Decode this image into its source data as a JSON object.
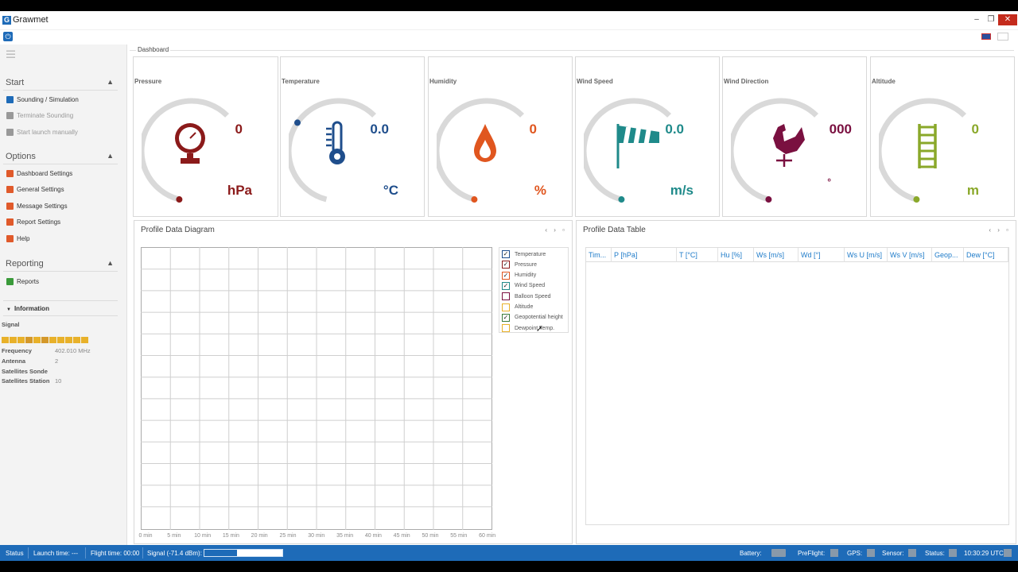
{
  "window": {
    "title": "Grawmet",
    "minimize": "–",
    "maximize": "❐",
    "close": "✕"
  },
  "sidebar": {
    "sections": [
      {
        "title": "Start",
        "items": [
          {
            "label": "Sounding / Simulation",
            "color": "#1e6bb8",
            "disabled": false
          },
          {
            "label": "Terminate Sounding",
            "color": "#999999",
            "disabled": true
          },
          {
            "label": "Start launch manually",
            "color": "#999999",
            "disabled": true
          }
        ]
      },
      {
        "title": "Options",
        "items": [
          {
            "label": "Dashboard Settings",
            "color": "#e05a2b",
            "disabled": false
          },
          {
            "label": "General Settings",
            "color": "#e05a2b",
            "disabled": false
          },
          {
            "label": "Message Settings",
            "color": "#e05a2b",
            "disabled": false
          },
          {
            "label": "Report Settings",
            "color": "#e05a2b",
            "disabled": false
          },
          {
            "label": "Help",
            "color": "#e05a2b",
            "disabled": false
          }
        ]
      },
      {
        "title": "Reporting",
        "items": [
          {
            "label": "Reports",
            "color": "#3a9a3a",
            "disabled": false
          }
        ]
      }
    ],
    "information": {
      "title": "Information",
      "signal_label": "Signal",
      "rows": [
        {
          "label": "Frequency",
          "value": "402.010 MHz"
        },
        {
          "label": "Antenna",
          "value": "2"
        },
        {
          "label": "Satellites Sonde",
          "value": ""
        },
        {
          "label": "Satellites Station",
          "value": "10"
        }
      ]
    }
  },
  "dashboard": {
    "tab_label": "Dashboard",
    "gauges": [
      {
        "title": "Pressure",
        "value": "0",
        "unit": "hPa",
        "color": "#8b1a1a",
        "icon": "pressure-gauge-icon"
      },
      {
        "title": "Temperature",
        "value": "0.0",
        "unit": "°C",
        "color": "#1f4e8c",
        "icon": "thermometer-icon"
      },
      {
        "title": "Humidity",
        "value": "0",
        "unit": "%",
        "color": "#e0561f",
        "icon": "water-drop-icon"
      },
      {
        "title": "Wind Speed",
        "value": "0.0",
        "unit": "m/s",
        "color": "#1f8a8a",
        "icon": "windsock-icon"
      },
      {
        "title": "Wind Direction",
        "value": "000",
        "unit": "°",
        "color": "#7a1040",
        "icon": "weathercock-icon"
      },
      {
        "title": "Altitude",
        "value": "0",
        "unit": "m",
        "color": "#8aa82a",
        "icon": "ladder-icon"
      }
    ]
  },
  "diagram": {
    "title": "Profile Data Diagram",
    "controls": "‹ › ▫",
    "x_ticks": [
      "0 min",
      "5 min",
      "10 min",
      "15 min",
      "20 min",
      "25 min",
      "30 min",
      "35 min",
      "40 min",
      "45 min",
      "50 min",
      "55 min",
      "60 min"
    ],
    "legend": [
      {
        "label": "Temperature",
        "checked": true,
        "color": "#1f4e8c"
      },
      {
        "label": "Pressure",
        "checked": true,
        "color": "#8b1a1a"
      },
      {
        "label": "Humidity",
        "checked": true,
        "color": "#e0561f"
      },
      {
        "label": "Wind Speed",
        "checked": true,
        "color": "#1f8a8a"
      },
      {
        "label": "Balloon Speed",
        "checked": false,
        "color": "#7a1040"
      },
      {
        "label": "Altitude",
        "checked": false,
        "color": "#e8b12a"
      },
      {
        "label": "Geopotential height",
        "checked": true,
        "color": "#3a7a3a"
      },
      {
        "label": "Dewpoint Temp.",
        "checked": false,
        "color": "#e8b12a"
      }
    ]
  },
  "table": {
    "title": "Profile Data Table",
    "controls": "‹ › ▫",
    "columns": [
      "Tim...",
      "P [hPa]",
      "T [°C]",
      "Hu [%]",
      "Ws [m/s]",
      "Wd [°]",
      "Ws U [m/s]",
      "Ws V [m/s]",
      "Geop...",
      "Dew [°C]"
    ]
  },
  "statusbar": {
    "status": "Status",
    "launch_time": "Launch time: ---",
    "flight_time": "Flight time: 00:00",
    "signal": "Signal (-71.4 dBm):",
    "signal_fraction": 0.42,
    "battery": "Battery:",
    "preflight": "PreFlight:",
    "gps": "GPS:",
    "sensor": "Sensor:",
    "status2": "Status:",
    "clock": "10:30:29 UTC"
  }
}
